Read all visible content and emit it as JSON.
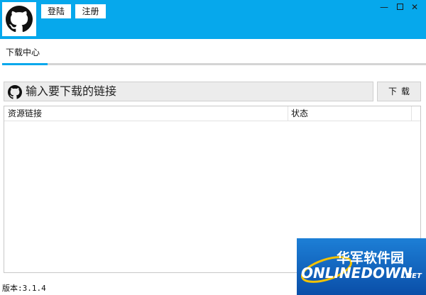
{
  "window": {
    "controls": {
      "minimize": "—",
      "maximize": "☐",
      "close": "✕"
    }
  },
  "header": {
    "logo_icon": "github-icon",
    "login_label": "登陆",
    "register_label": "注册",
    "accent_color": "#06a8ec"
  },
  "tabs": [
    {
      "label": "下载中心",
      "active": true
    }
  ],
  "download": {
    "url_placeholder": "输入要下载的链接",
    "url_value": "",
    "button_label": "下载"
  },
  "table": {
    "columns": [
      "资源链接",
      "状态"
    ],
    "rows": []
  },
  "footer": {
    "version": "版本:3.1.4"
  },
  "watermark": {
    "title": "华军软件园",
    "brand": "ONLINEDOWN",
    "suffix": ".NET"
  }
}
